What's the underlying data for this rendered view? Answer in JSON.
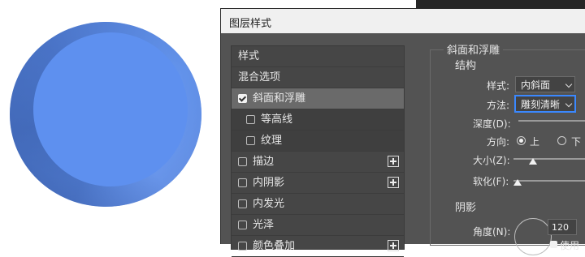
{
  "dialog": {
    "title": "图层样式"
  },
  "styles_list": [
    {
      "label": "样式",
      "checkbox": false,
      "checked": false,
      "plus": false,
      "sub": false,
      "selected": false
    },
    {
      "label": "混合选项",
      "checkbox": false,
      "checked": false,
      "plus": false,
      "sub": false,
      "selected": false
    },
    {
      "label": "斜面和浮雕",
      "checkbox": true,
      "checked": true,
      "plus": false,
      "sub": false,
      "selected": true
    },
    {
      "label": "等高线",
      "checkbox": true,
      "checked": false,
      "plus": false,
      "sub": true,
      "selected": false
    },
    {
      "label": "纹理",
      "checkbox": true,
      "checked": false,
      "plus": false,
      "sub": true,
      "selected": false
    },
    {
      "label": "描边",
      "checkbox": true,
      "checked": false,
      "plus": true,
      "sub": false,
      "selected": false
    },
    {
      "label": "内阴影",
      "checkbox": true,
      "checked": false,
      "plus": true,
      "sub": false,
      "selected": false
    },
    {
      "label": "内发光",
      "checkbox": true,
      "checked": false,
      "plus": false,
      "sub": false,
      "selected": false
    },
    {
      "label": "光泽",
      "checkbox": true,
      "checked": false,
      "plus": false,
      "sub": false,
      "selected": false
    },
    {
      "label": "颜色叠加",
      "checkbox": true,
      "checked": false,
      "plus": true,
      "sub": false,
      "selected": false
    }
  ],
  "bevel": {
    "section_title": "斜面和浮雕",
    "structure_title": "结构",
    "style_label": "样式:",
    "style_value": "内斜面",
    "technique_label": "方法:",
    "technique_value": "雕刻清晰",
    "depth_label": "深度(D):",
    "direction_label": "方向:",
    "direction_up": "上",
    "direction_down": "下",
    "size_label": "大小(Z):",
    "soften_label": "软化(F):",
    "shading_title": "阴影",
    "angle_label": "角度(N):",
    "angle_value": "120",
    "use_global_label": "使用"
  },
  "colors": {
    "button_blue": "#5e90ef",
    "focus_blue": "#3a88ff",
    "dialog_bg": "#535353"
  }
}
